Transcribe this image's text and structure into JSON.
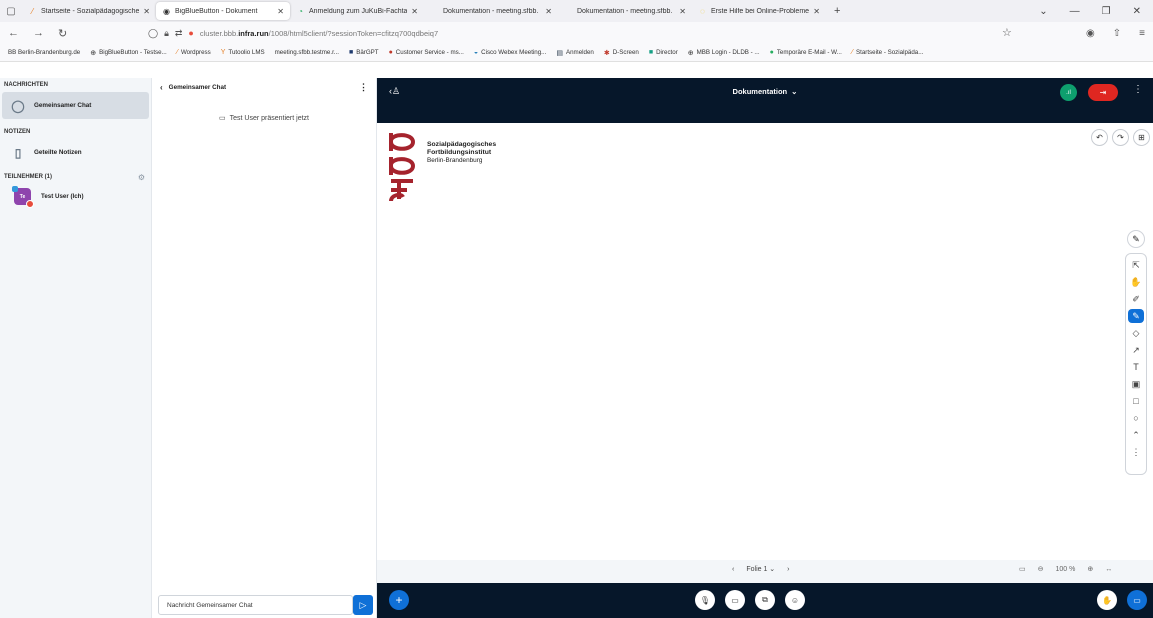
{
  "browser": {
    "tabs": [
      {
        "label": "Startseite - Sozialpädagogische",
        "icon": "⁄"
      },
      {
        "label": "BigBlueButton - Dokument",
        "icon": "◉"
      },
      {
        "label": "Anmeldung zum JuKuBi-Fachta",
        "icon": "◔"
      },
      {
        "label": "Dokumentation - meeting.sfbb.",
        "icon": ""
      },
      {
        "label": "Dokumentation - meeting.sfbb.",
        "icon": ""
      },
      {
        "label": "Erste Hilfe bei Online-Probleme",
        "icon": "◌"
      }
    ],
    "url_prefix": "cluster.bbb.",
    "url_domain": "infra.run",
    "url_suffix": "/1008/html5client/?sessionToken=cfitzq700qdbeiq7",
    "bookmarks": [
      "BB Berlin-Brandenburg.de",
      "BigBlueButton - Testse...",
      "Wordpress",
      "Tutoolio LMS",
      "meeting.sfbb.testme.r...",
      "BärGPT",
      "Customer Service - ms...",
      "Cisco Webex Meeting...",
      "Anmelden",
      "D-Screen",
      "Director",
      "MBB Login - DLDB - ...",
      "Temporäre E-Mail - W...",
      "Startseite - Sozialpäda..."
    ]
  },
  "left": {
    "messages_title": "NACHRICHTEN",
    "public_chat": "Gemeinsamer Chat",
    "notes_title": "NOTIZEN",
    "shared_notes": "Geteilte Notizen",
    "users_title": "TEILNEHMER (1)",
    "user_name": "Test User (Ich)",
    "user_initials": "Te"
  },
  "chat": {
    "title": "Gemeinsamer Chat",
    "presenting": "Test User präsentiert jetzt",
    "placeholder": "Nachricht Gemeinsamer Chat"
  },
  "main": {
    "title": "Dokumentation",
    "logo_line1": "Sozialpädagogisches",
    "logo_line2": "Fortbildungsinstitut",
    "logo_line3": "Berlin-Brandenburg",
    "slide_label": "Folie 1",
    "zoom": "100 %"
  },
  "colors": {
    "accent": "#0f70d7",
    "dark": "#06172a",
    "leave": "#df2721",
    "logo": "#a5232d"
  }
}
